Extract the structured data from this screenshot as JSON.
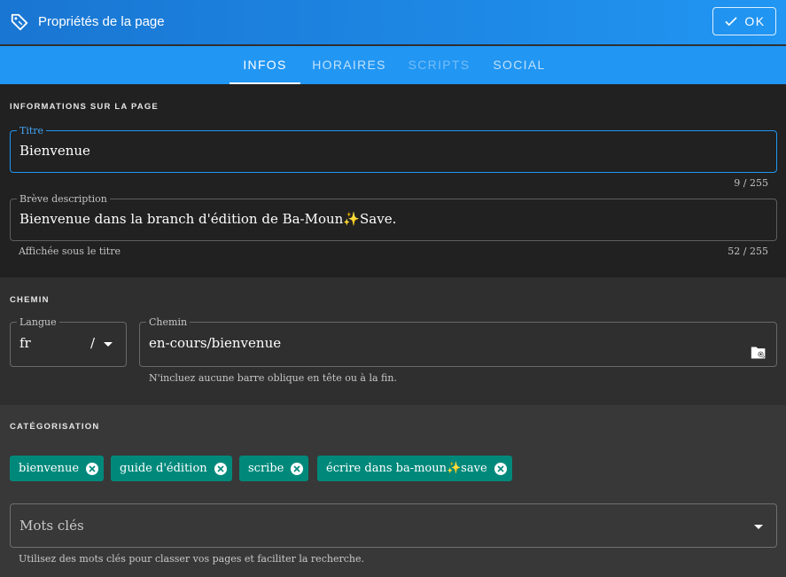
{
  "dialog": {
    "title": "Propriétés de la page",
    "ok_label": "OK",
    "tag_icon": "tag-icon",
    "check_icon": "check-icon"
  },
  "tabs": [
    {
      "label": "INFOS",
      "state": "active"
    },
    {
      "label": "HORAIRES",
      "state": "normal"
    },
    {
      "label": "SCRIPTS",
      "state": "disabled"
    },
    {
      "label": "SOCIAL",
      "state": "normal"
    }
  ],
  "info_section": {
    "title": "INFORMATIONS SUR LA PAGE",
    "title_field": {
      "label": "Titre",
      "value": "Bienvenue",
      "counter": "9 / 255"
    },
    "description_field": {
      "label": "Brève description",
      "value": "Bienvenue dans la branch d'édition de Ba-Moun✨Save.",
      "hint": "Affichée sous le titre",
      "counter": "52 / 255"
    }
  },
  "path_section": {
    "title": "CHEMIN",
    "language_field": {
      "label": "Langue",
      "value": "fr",
      "separator": "/"
    },
    "path_field": {
      "label": "Chemin",
      "value": "en-cours/bienvenue",
      "hint": "N'incluez aucune barre oblique en tête ou à la fin.",
      "icon": "folder-search-icon"
    }
  },
  "categorisation_section": {
    "title": "CATÉGORISATION",
    "tags": [
      "bienvenue",
      "guide d'édition",
      "scribe",
      "écrire dans ba-moun✨save"
    ],
    "keywords_field": {
      "placeholder": "Mots clés",
      "hint": "Utilisez des mots clés pour classer vos pages et faciliter la recherche."
    }
  },
  "colors": {
    "header": "#1e88e5",
    "tabs_bar": "#2196f3",
    "chip": "#00897b",
    "focus": "#2196f3"
  }
}
